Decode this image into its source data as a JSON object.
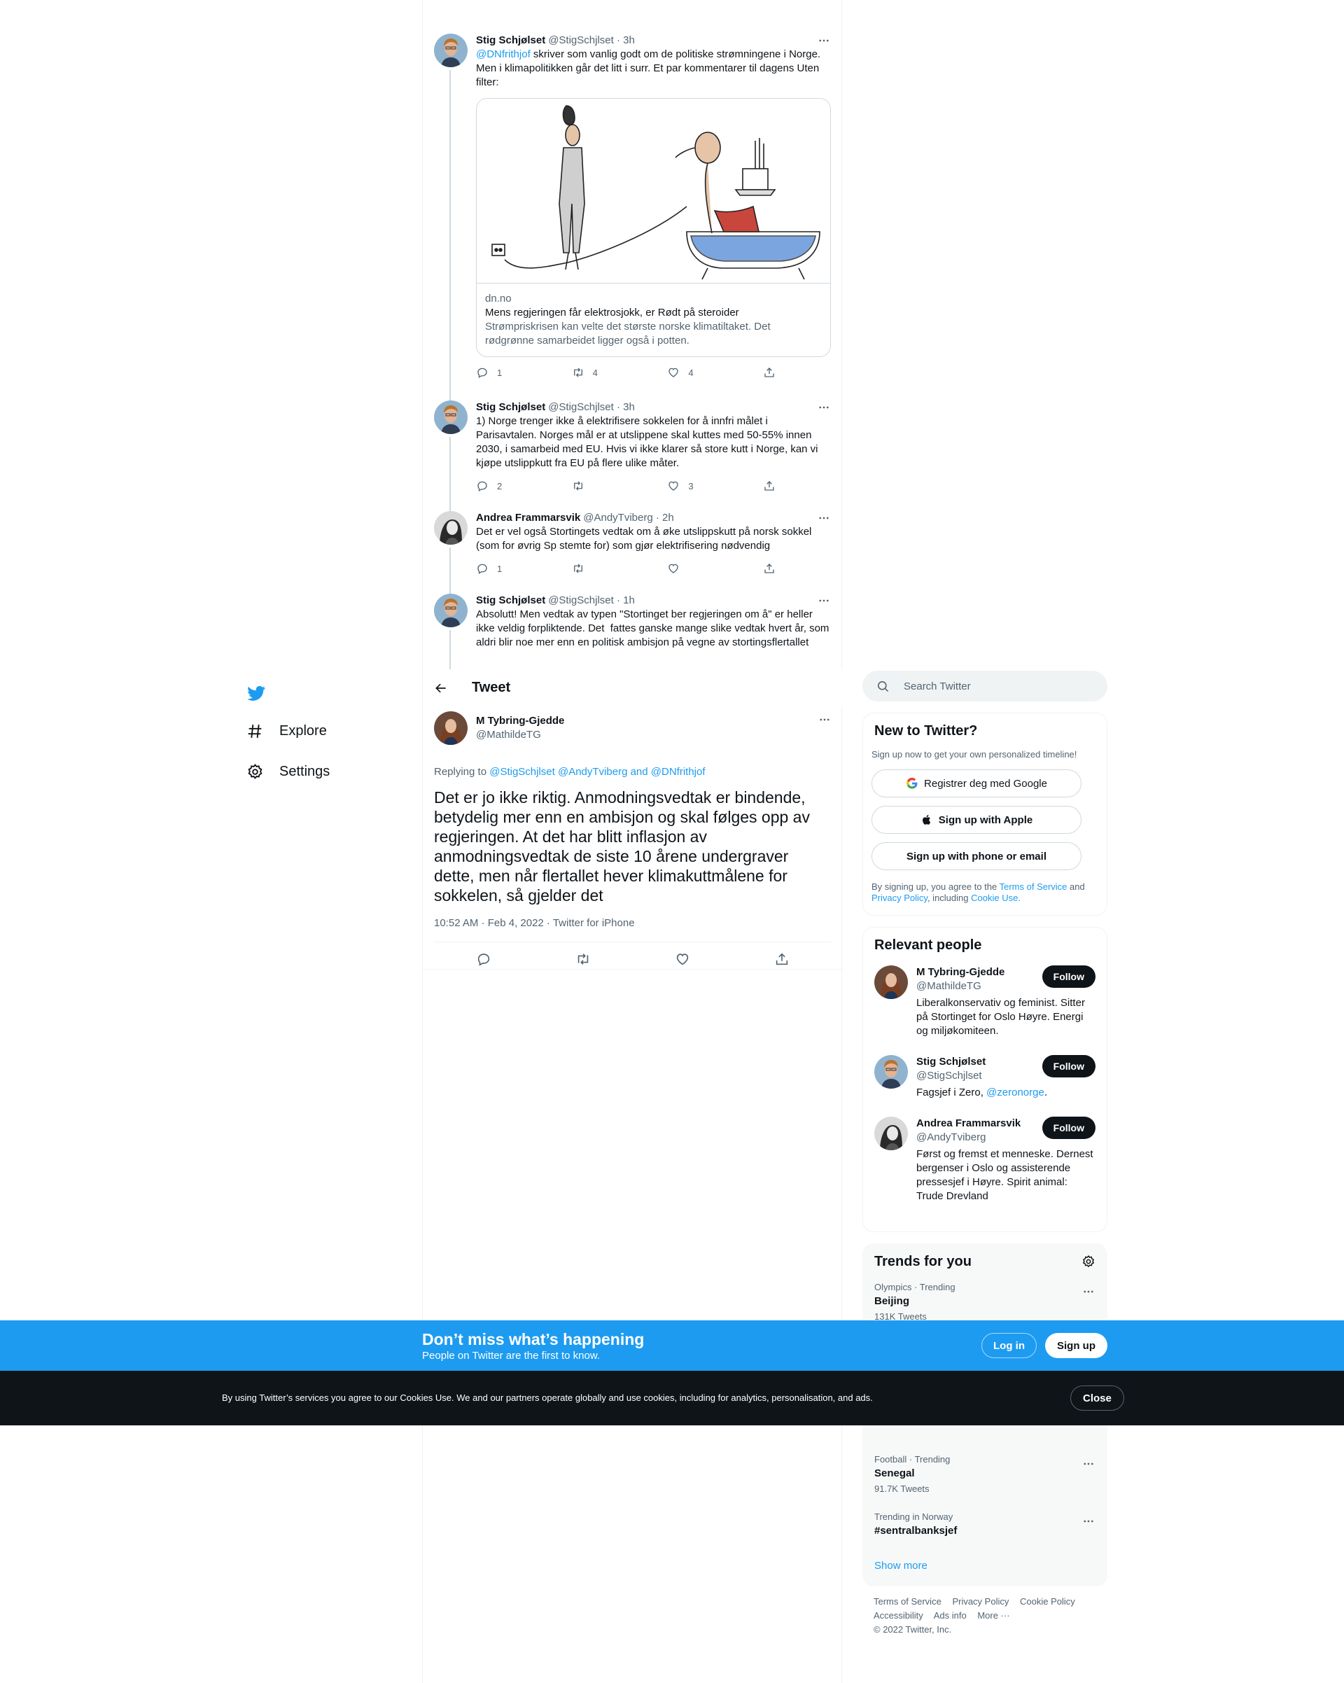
{
  "nav": {
    "items": [
      {
        "label": "Explore",
        "icon": "hashtag-icon"
      },
      {
        "label": "Settings",
        "icon": "gear-icon"
      }
    ]
  },
  "thread": [
    {
      "name": "Stig Schjølset",
      "handle": "@StigSchjlset",
      "time": "3h",
      "mention": "@DNfrithjof",
      "text": " skriver som vanlig godt om de politiske strømningene i Norge. Men i klimapolitikken går det litt i surr. Et par kommentarer til dagens Uten filter:",
      "card": {
        "domain": "dn.no",
        "title": "Mens regjeringen får elektrosjokk, er Rødt på steroider",
        "description": "Strømpriskrisen kan velte det største norske klimatiltaket. Det rødgrønne samarbeidet ligger også i potten."
      },
      "replies": "1",
      "retweets": "4",
      "likes": "4"
    },
    {
      "name": "Stig Schjølset",
      "handle": "@StigSchjlset",
      "time": "3h",
      "text": "1) Norge trenger ikke å elektrifisere sokkelen for å innfri målet i Parisavtalen. Norges mål er at utslippene skal kuttes med 50-55% innen 2030, i samarbeid med EU. Hvis vi ikke klarer så store kutt i Norge, kan vi kjøpe utslippkutt fra EU på flere ulike måter.",
      "replies": "2",
      "retweets": "",
      "likes": "3"
    },
    {
      "name": "Andrea Frammarsvik",
      "handle": "@AndyTviberg",
      "time": "2h",
      "text": "Det er vel også Stortingets vedtak om å øke utslippskutt på norsk sokkel (som for øvrig Sp stemte for) som gjør elektrifisering nødvendig",
      "replies": "1",
      "retweets": "",
      "likes": ""
    },
    {
      "name": "Stig Schjølset",
      "handle": "@StigSchjlset",
      "time": "1h",
      "text": "Absolutt! Men vedtak av typen \"Stortinget ber regjeringen om å\" er heller ikke veldig forpliktende. Det  fattes ganske mange slike vedtak hvert år, som aldri blir noe mer enn en politisk ambisjon på vegne av stortingsflertallet"
    }
  ],
  "header": {
    "title": "Tweet"
  },
  "focal": {
    "name": "M Tybring-Gjedde",
    "handle": "@MathildeTG",
    "replying_prefix": "Replying to ",
    "replying_to": "@StigSchjlset @AndyTviberg and @DNfrithjof",
    "text": "Det er jo ikke riktig. Anmodningsvedtak er bindende, betydelig mer enn en ambisjon og skal følges opp av regjeringen. At det har blitt inflasjon av anmodningsvedtak de siste 10 årene undergraver dette, men når flertallet hever klimakuttmålene for sokkelen, så gjelder det",
    "meta": "10:52 AM · Feb 4, 2022 · Twitter for iPhone"
  },
  "search": {
    "placeholder": "Search Twitter"
  },
  "new_to_twitter": {
    "title": "New to Twitter?",
    "subtitle": "Sign up now to get your own personalized timeline!",
    "google": "Registrer deg med Google",
    "apple": "Sign up with Apple",
    "phone": "Sign up with phone or email",
    "legal_1": "By signing up, you agree to the ",
    "terms": "Terms of Service",
    "legal_2": " and ",
    "privacy": "Privacy Policy",
    "legal_3": ", including ",
    "cookie": "Cookie Use.",
    "legal_4": ""
  },
  "relevant": {
    "title": "Relevant people",
    "follow_label": "Follow",
    "people": [
      {
        "name": "M Tybring-Gjedde",
        "handle": "@MathildeTG",
        "bio": "Liberalkonservativ og feminist. Sitter på Stortinget for Oslo Høyre. Energi og miljøkomiteen."
      },
      {
        "name": "Stig Schjølset",
        "handle": "@StigSchjlset",
        "bio": "Fagsjef i Zero, ",
        "bio_link": "@zeronorge",
        "bio_end": "."
      },
      {
        "name": "Andrea Frammarsvik",
        "handle": "@AndyTviberg",
        "bio": "Først og fremst et menneske. Dernest bergenser i Oslo og assisterende pressesjef i Høyre. Spirit animal: Trude Drevland"
      }
    ]
  },
  "trends": {
    "title": "Trends for you",
    "items": [
      {
        "category": "Olympics · Trending",
        "name": "Beijing",
        "count": "131K Tweets"
      },
      {
        "category": "Football · Trending",
        "name": "Senegal",
        "count": "91.7K Tweets"
      },
      {
        "category": "Trending in Norway",
        "name": "#sentralbanksjef",
        "count": ""
      }
    ],
    "show_more": "Show more"
  },
  "footer": {
    "links": [
      "Terms of Service",
      "Privacy Policy",
      "Cookie Policy"
    ],
    "links2": [
      "Accessibility",
      "Ads info",
      "More ···"
    ],
    "copyright": "© 2022 Twitter, Inc."
  },
  "signup_bar": {
    "title": "Don’t miss what’s happening",
    "subtitle": "People on Twitter are the first to know.",
    "login": "Log in",
    "signup": "Sign up"
  },
  "cookie_bar": {
    "text": "By using Twitter’s services you agree to our Cookies Use. We and our partners operate globally and use cookies, including for analytics, personalisation, and ads.",
    "close": "Close"
  },
  "colors": {
    "accent": "#1d9bf0",
    "text": "#0f1419",
    "secondary": "#536471",
    "border": "#eff3f4"
  }
}
